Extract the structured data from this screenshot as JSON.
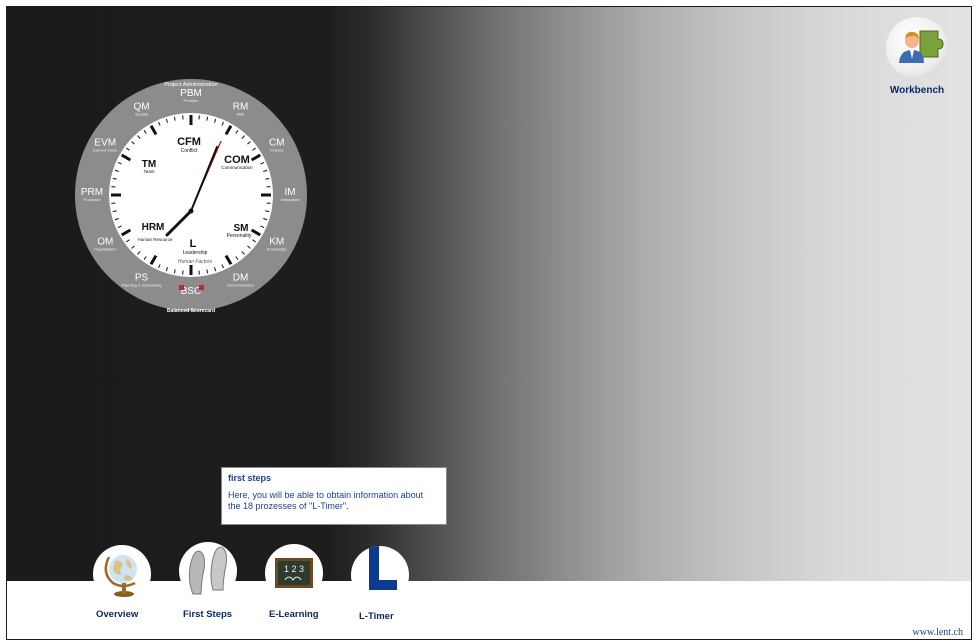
{
  "clock": {
    "center": {
      "top": "Project Administration",
      "bottom": "Balanced Scorecard"
    },
    "outer_ring": [
      {
        "abbr": "PBM",
        "name": "Problem"
      },
      {
        "abbr": "RM",
        "name": "Risk"
      },
      {
        "abbr": "CM",
        "name": "Change"
      },
      {
        "abbr": "IM",
        "name": "Integration"
      },
      {
        "abbr": "KM",
        "name": "Knowledge"
      },
      {
        "abbr": "DM",
        "name": "Documentation"
      },
      {
        "abbr": "BSC",
        "name": ""
      },
      {
        "abbr": "PS",
        "name": "Planning & Scheduling"
      },
      {
        "abbr": "OM",
        "name": "Organisation"
      },
      {
        "abbr": "PRM",
        "name": "Purchase"
      },
      {
        "abbr": "EVM",
        "name": "Earned Value"
      },
      {
        "abbr": "QM",
        "name": "Quality"
      }
    ],
    "inner": [
      {
        "abbr": "CFM",
        "name": "Conflict"
      },
      {
        "abbr": "COM",
        "name": "Communication"
      },
      {
        "abbr": "SM",
        "name": "Personality"
      },
      {
        "abbr": "L",
        "name": "Leadership"
      },
      {
        "abbr": "HRM",
        "name": "Human Resource"
      },
      {
        "abbr": "TM",
        "name": "Team"
      }
    ],
    "human_factors": "Human Factors"
  },
  "workbench": {
    "label": "Workbench"
  },
  "tooltip": {
    "title": "first steps",
    "body_line1": "Here, you will be able to obtain information about",
    "body_line2": "the 18 prozesses of \"L-Timer\"."
  },
  "nav": {
    "overview": "Overview",
    "first_steps": "First Steps",
    "e_learning": "E-Learning",
    "l_timer": "L-Timer"
  },
  "chalkboard_text": "1 2 3",
  "footer": {
    "site": "www.lent.ch"
  },
  "colors": {
    "nav_text": "#0a2a66",
    "tooltip_text": "#1d3f9a",
    "clock_hand_red": "#cc0000",
    "ltimer_blue": "#0b3a8f"
  }
}
